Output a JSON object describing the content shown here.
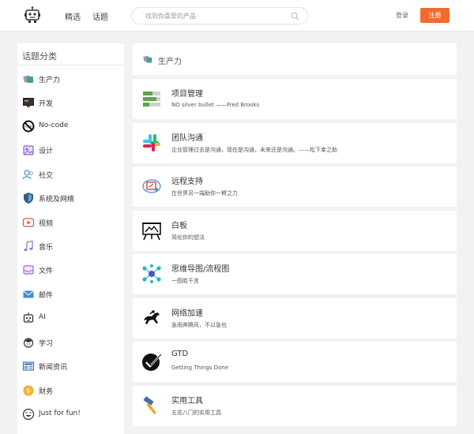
{
  "header": {
    "nav": [
      "精选",
      "话题"
    ],
    "search_placeholder": "找到你喜爱的产品",
    "login": "登录",
    "signup": "注册"
  },
  "sidebar": {
    "title": "话题分类",
    "items": [
      {
        "label": "生产力",
        "icon": "productivity-icon"
      },
      {
        "label": "开发",
        "icon": "monitor-icon"
      },
      {
        "label": "No-code",
        "icon": "no-code-icon"
      },
      {
        "label": "设计",
        "icon": "design-icon"
      },
      {
        "label": "社交",
        "icon": "people-icon"
      },
      {
        "label": "系统及网络",
        "icon": "shield-icon"
      },
      {
        "label": "视频",
        "icon": "video-icon"
      },
      {
        "label": "音乐",
        "icon": "music-icon"
      },
      {
        "label": "文件",
        "icon": "inbox-icon"
      },
      {
        "label": "邮件",
        "icon": "mail-icon"
      },
      {
        "label": "AI",
        "icon": "robot-icon"
      },
      {
        "label": "学习",
        "icon": "student-icon"
      },
      {
        "label": "新闻资讯",
        "icon": "news-icon"
      },
      {
        "label": "财务",
        "icon": "coin-icon"
      },
      {
        "label": "Just for fun!",
        "icon": "smile-icon"
      }
    ]
  },
  "main": {
    "title": "生产力",
    "cards": [
      {
        "name": "项目管理",
        "desc": "NO silver bullet ——Fred Brooks",
        "icon": "kanban-icon"
      },
      {
        "name": "团队沟通",
        "desc": "企业管理过去是沟通，现在是沟通，未来还是沟通。——松下幸之助",
        "icon": "slack-icon"
      },
      {
        "name": "远程支持",
        "desc": "在世界另一端助你一臂之力",
        "icon": "remote-icon"
      },
      {
        "name": "白板",
        "desc": "简化你的想法",
        "icon": "whiteboard-icon"
      },
      {
        "name": "思维导图/流程图",
        "desc": "一图胜千言",
        "icon": "mindmap-icon"
      },
      {
        "name": "网络加速",
        "desc": "急雨奔腾风，不以急也",
        "icon": "horse-icon"
      },
      {
        "name": "GTD",
        "desc": "Getting Things Done",
        "icon": "check-circle-icon"
      },
      {
        "name": "实用工具",
        "desc": "五花八门的实用工具",
        "icon": "hammer-icon"
      }
    ]
  },
  "colors": {
    "accent": "#f06c2c",
    "background": "#f1f2f4"
  }
}
